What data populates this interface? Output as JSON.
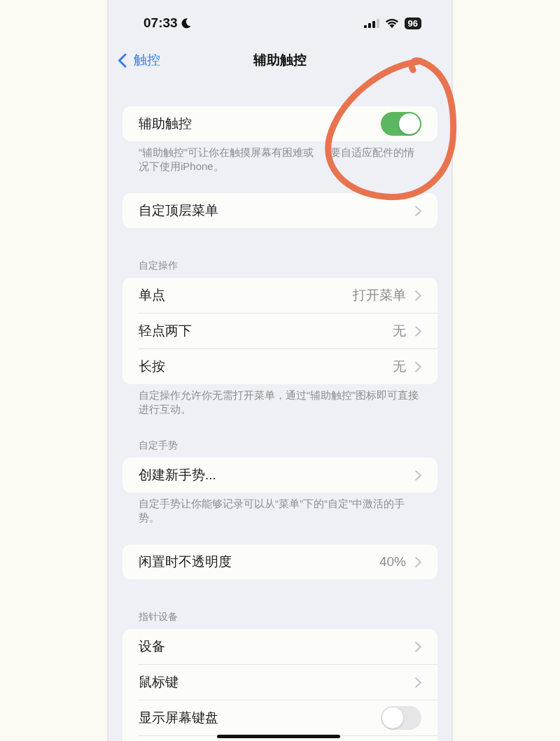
{
  "status_bar": {
    "time": "07:33",
    "battery": "96"
  },
  "nav": {
    "back": "触控",
    "title": "辅助触控"
  },
  "groups": [
    {
      "rows": [
        {
          "kind": "toggle",
          "label": "辅助触控",
          "on": true
        }
      ],
      "footer": [
        "“辅助触控”可让你在触摸屏幕有困难或",
        "要自适应配件的情况下使用iPhone。"
      ]
    },
    {
      "rows": [
        {
          "kind": "link",
          "label": "自定顶层菜单"
        }
      ]
    },
    {
      "header": "自定操作",
      "rows": [
        {
          "kind": "link",
          "label": "单点",
          "value": "打开菜单"
        },
        {
          "kind": "link",
          "label": "轻点两下",
          "value": "无"
        },
        {
          "kind": "link",
          "label": "长按",
          "value": "无"
        }
      ],
      "footer": [
        "自定操作允许你无需打开菜单，通过“辅助触控”图标即可直接进行互动。"
      ]
    },
    {
      "header": "自定手势",
      "rows": [
        {
          "kind": "link",
          "label": "创建新手势..."
        }
      ],
      "footer": [
        "自定手势让你能够记录可以从“菜单”下的“自定”中激活的手势。"
      ]
    },
    {
      "rows": [
        {
          "kind": "link",
          "label": "闲置时不透明度",
          "value": "40%"
        }
      ]
    },
    {
      "header": "指针设备",
      "rows": [
        {
          "kind": "link",
          "label": "设备"
        },
        {
          "kind": "link",
          "label": "鼠标键"
        },
        {
          "kind": "toggle",
          "label": "显示屏幕键盘",
          "on": false
        }
      ]
    }
  ]
}
